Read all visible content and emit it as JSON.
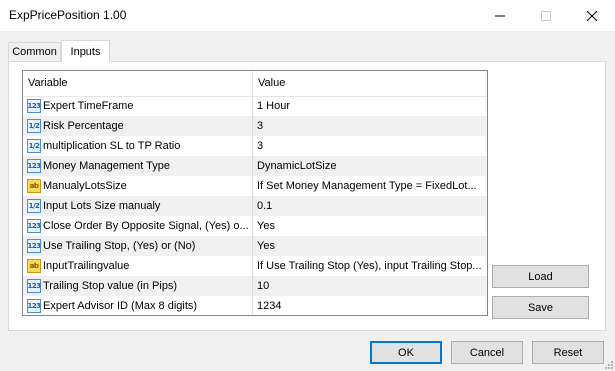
{
  "window": {
    "title": "ExpPricePosition 1.00"
  },
  "tabs": [
    {
      "label": "Common"
    },
    {
      "label": "Inputs"
    }
  ],
  "table": {
    "headers": {
      "variable": "Variable",
      "value": "Value"
    },
    "rows": [
      {
        "icon": "123",
        "variable": "Expert TimeFrame",
        "value": "1 Hour"
      },
      {
        "icon": "1/2",
        "variable": "Risk Percentage",
        "value": "3"
      },
      {
        "icon": "1/2",
        "variable": "multiplication SL to TP Ratio",
        "value": "3"
      },
      {
        "icon": "123",
        "variable": "Money Management Type",
        "value": "DynamicLotSize"
      },
      {
        "icon": "ab",
        "variable": "ManualyLotsSize",
        "value": "If Set Money Management Type = FixedLot..."
      },
      {
        "icon": "1/2",
        "variable": "Input Lots Size manualy",
        "value": "0.1"
      },
      {
        "icon": "123",
        "variable": "Close Order By Opposite Signal, (Yes) o...",
        "value": "Yes"
      },
      {
        "icon": "123",
        "variable": "Use Trailing Stop, (Yes) or (No)",
        "value": "Yes"
      },
      {
        "icon": "ab",
        "variable": "InputTrailingvalue",
        "value": "If Use Trailing Stop (Yes), input Trailing Stop..."
      },
      {
        "icon": "123",
        "variable": "Trailing Stop value (in Pips)",
        "value": "10"
      },
      {
        "icon": "123",
        "variable": "Expert Advisor ID (Max 8 digits)",
        "value": "1234"
      }
    ]
  },
  "side_buttons": {
    "load": "Load",
    "save": "Save"
  },
  "footer_buttons": {
    "ok": "OK",
    "cancel": "Cancel",
    "reset": "Reset"
  },
  "icons": {
    "minimize": "minimize-icon",
    "maximize": "maximize-icon",
    "close": "close-icon"
  }
}
